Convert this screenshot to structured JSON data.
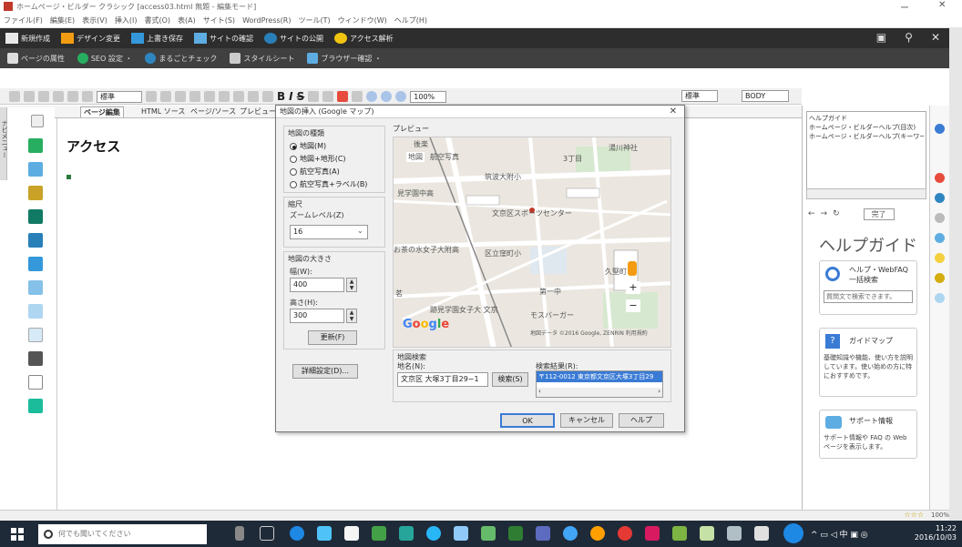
{
  "window": {
    "title": "ホームページ・ビルダー クラシック [access03.html 無題 - 編集モード]",
    "min": "ー",
    "close": "✕"
  },
  "menu": [
    "ファイル(F)",
    "編集(E)",
    "表示(V)",
    "挿入(I)",
    "書式(O)",
    "表(A)",
    "サイト(S)",
    "WordPress(R)",
    "ツール(T)",
    "ウィンドウ(W)",
    "ヘルプ(H)"
  ],
  "dark_toolbar": {
    "items": [
      "新規作成",
      "デザイン変更",
      "上書き保存",
      "サイトの確認",
      "サイトの公開",
      "アクセス解析"
    ],
    "right": [
      "▣",
      "⚲",
      "✕"
    ]
  },
  "toolbar2": {
    "items": [
      "ページの属性",
      "SEO 設定 ・",
      "まるごとチェック",
      "スタイルシート",
      "ブラウザー確認 ・"
    ]
  },
  "format_bar": {
    "style_select": "標準",
    "zoom": "100%",
    "bold": "B",
    "italic": "I",
    "strike": "S",
    "tag": "BODY",
    "std": "標準"
  },
  "tabs": [
    "ページ編集",
    "HTML ソース",
    "ページ/ソース",
    "プレビュー"
  ],
  "editor": {
    "heading": "アクセス"
  },
  "dialog": {
    "title": "地図の挿入 (Google マップ)",
    "close": "✕",
    "map_type_label": "地図の種類",
    "map_types": [
      "地図(M)",
      "地図+地形(C)",
      "航空写真(A)",
      "航空写真+ラベル(B)"
    ],
    "scale_label": "縮尺",
    "zoom_label": "ズームレベル(Z)",
    "zoom_value": "16",
    "size_label": "地図の大きさ",
    "width_label": "幅(W):",
    "width_value": "400",
    "height_label": "高さ(H):",
    "height_value": "300",
    "update_button": "更新(F)",
    "detail_button": "詳細設定(D)...",
    "preview_label": "プレビュー",
    "map_tabs": [
      "地図",
      "航空写真"
    ],
    "map_labels": [
      "筑波大附小",
      "文京区スポーツセンター",
      "お茶の水女子大附高",
      "区立窪町小",
      "第一中",
      "跡見学園女子大 文京",
      "モスバーガー",
      "見学園中高",
      "後楽",
      "茗",
      "久堅町",
      "湯川神社",
      "3丁目"
    ],
    "map_footer": "地図データ ©2016 Google, ZENRIN  利用規約",
    "google": "Google",
    "search_label": "地図検索",
    "place_label": "地名(N):",
    "place_value": "文京区 大塚3丁目29−1",
    "search_button": "検索(S)",
    "result_label": "検索結果(R):",
    "result_value": "〒112-0012 東京都文京区大塚3丁目29",
    "ok": "OK",
    "cancel": "キャンセル",
    "help": "ヘルプ"
  },
  "right_panel": {
    "tree": [
      "ヘルプガイド",
      "ホームページ・ビルダーヘルプ(目次)",
      "ホームページ・ビルダーヘルプ(キーワード)"
    ],
    "nav_done": "完了",
    "help_title": "ヘルプガイド",
    "card1_title": "ヘルプ・WebFAQ 一括検索",
    "card1_input": "質問文で検索できます。",
    "card2_title": "ガイドマップ",
    "card2_text": "基礎知識や機能、使い方を説明しています。使い始めの方に特におすすめです。",
    "card3_title": "サポート情報",
    "card3_text": "サポート情報や FAQ の Web ページを表示します。"
  },
  "left_tab": "ナビメニュー",
  "status": {
    "zoom": "100%",
    "stars": "☆☆☆"
  },
  "taskbar": {
    "search_placeholder": "何でも聞いてください",
    "time": "11:22",
    "date": "2016/10/03"
  },
  "colors": {
    "dark_toolbar": "#2d2d2d",
    "taskbar": "#1f2a38",
    "accent_blue": "#3a7bd5"
  }
}
